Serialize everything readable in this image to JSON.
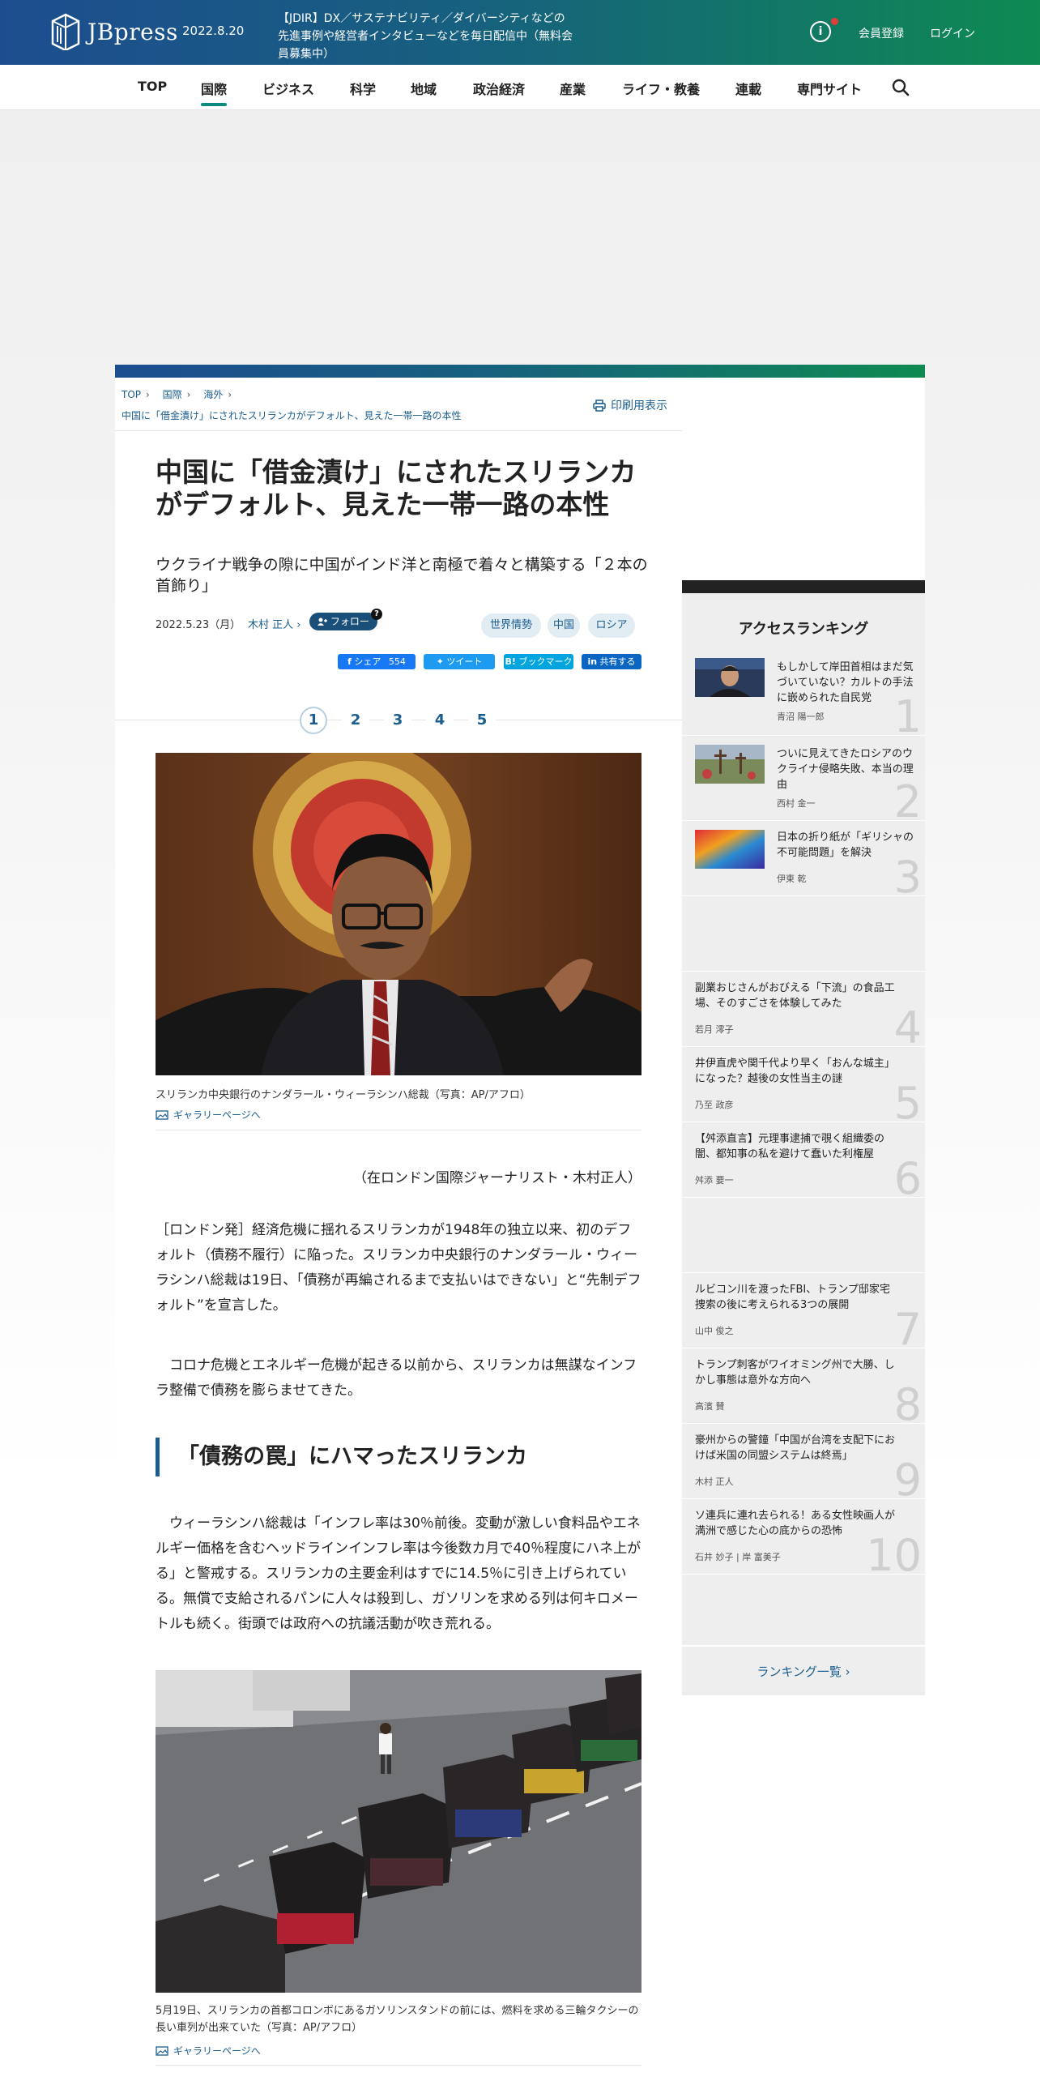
{
  "header": {
    "logo_text": "JBpress",
    "date": "2022.8.20",
    "news": "【JDIR】DX／サステナビリティ／ダイバーシティなどの先進事例や経営者インタビューなどを毎日配信中（無料会員募集中）",
    "register": "会員登録",
    "login": "ログイン",
    "info_icon": "i"
  },
  "nav": {
    "items": [
      "TOP",
      "国際",
      "ビジネス",
      "科学",
      "地域",
      "政治経済",
      "産業",
      "ライフ・教養",
      "連載",
      "専門サイト"
    ],
    "active": "国際"
  },
  "breadcrumb": {
    "items": [
      "TOP",
      "国際",
      "海外"
    ],
    "current": "中国に「借金漬け」にされたスリランカがデフォルト、見えた一帯一路の本性",
    "print": "印刷用表示"
  },
  "article": {
    "title": "中国に「借金漬け」にされたスリランカがデフォルト、見えた一帯一路の本性",
    "subtitle": "ウクライナ戦争の隙に中国がインド洋と南極で着々と構築する「２本の首飾り」",
    "date": "2022.5.23（月）",
    "author": "木村 正人",
    "follow": "フォロー",
    "tags": [
      "世界情勢",
      "中国",
      "ロシア"
    ],
    "share": {
      "facebook": "シェア",
      "facebook_count": "554",
      "twitter": "ツイート",
      "hatena": "ブックマーク",
      "linkedin": "共有する"
    },
    "pages": [
      "1",
      "2",
      "3",
      "4",
      "5"
    ],
    "current_page": "1",
    "photo1_caption": "スリランカ中央銀行のナンダラール・ウィーラシンハ総裁（写真：AP/アフロ）",
    "gallery": "ギャラリーページへ",
    "byline": "（在ロンドン国際ジャーナリスト・木村正人）",
    "para1": "［ロンドン発］経済危機に揺れるスリランカが1948年の独立以来、初のデフォルト（債務不履行）に陥った。スリランカ中央銀行のナンダラール・ウィーラシンハ総裁は19日、「債務が再編されるまで支払いはできない」と“先制デフォルト”を宣言した。",
    "para2": "コロナ危機とエネルギー危機が起きる以前から、スリランカは無謀なインフラ整備で債務を膨らませてきた。",
    "heading2": "「債務の罠」にハマったスリランカ",
    "para3": "ウィーラシンハ総裁は「インフレ率は30％前後。変動が激しい食料品やエネルギー価格を含むヘッドラインインフレ率は今後数カ月で40％程度にハネ上がる」と警戒する。スリランカの主要金利はすでに14.5％に引き上げられている。無償で支給されるパンに人々は殺到し、ガソリンを求める列は何キロメートルも続く。街頭では政府への抗議活動が吹き荒れる。",
    "photo2_caption": "5月19日、スリランカの首都コロンボにあるガソリンスタンドの前には、燃料を求める三輪タクシーの長い車列が出来ていた（写真：AP/アフロ）"
  },
  "ranking": {
    "heading": "アクセスランキング",
    "items": [
      {
        "rank": "1",
        "title": "もしかして岸田首相はまだ気づいていない？カルトの手法に嵌められた自民党",
        "author": "青沼 陽一郎"
      },
      {
        "rank": "2",
        "title": "ついに見えてきたロシアのウクライナ侵略失敗、本当の理由",
        "author": "西村 金一"
      },
      {
        "rank": "3",
        "title": "日本の折り紙が「ギリシャの不可能問題」を解決",
        "author": "伊東 乾"
      },
      {
        "rank": "4",
        "title": "副業おじさんがおびえる「下流」の食品工場、そのすごさを体験してみた",
        "author": "若月 澪子"
      },
      {
        "rank": "5",
        "title": "井伊直虎や関千代より早く「おんな城主」になった？越後の女性当主の謎",
        "author": "乃至 政彦"
      },
      {
        "rank": "6",
        "title": "【舛添直言】元理事逮捕で覗く組織委の闇、都知事の私を避けて蠢いた利権屋",
        "author": "舛添 要一"
      },
      {
        "rank": "7",
        "title": "ルビコン川を渡ったFBI、トランプ邸家宅捜索の後に考えられる3つの展開",
        "author": "山中 俊之"
      },
      {
        "rank": "8",
        "title": "トランプ刺客がワイオミング州で大勝、しかし事態は意外な方向へ",
        "author": "高濱 賛"
      },
      {
        "rank": "9",
        "title": "豪州からの警鐘「中国が台湾を支配下におけば米国の同盟システムは終焉」",
        "author": "木村 正人"
      },
      {
        "rank": "10",
        "title": "ソ連兵に連れ去られる！ある女性映画人が満洲で感じた心の底からの恐怖",
        "author": "石井 妙子 | 岸 富美子"
      }
    ],
    "more": "ランキング一覧 ›"
  },
  "colors": {
    "brand_blue": "#1d4d8f",
    "brand_green": "#0e8a52",
    "link": "#1a5d8f",
    "facebook": "#1877f2",
    "twitter": "#1d9bf0",
    "hatena": "#00a4de",
    "linkedin": "#0a66c2"
  }
}
